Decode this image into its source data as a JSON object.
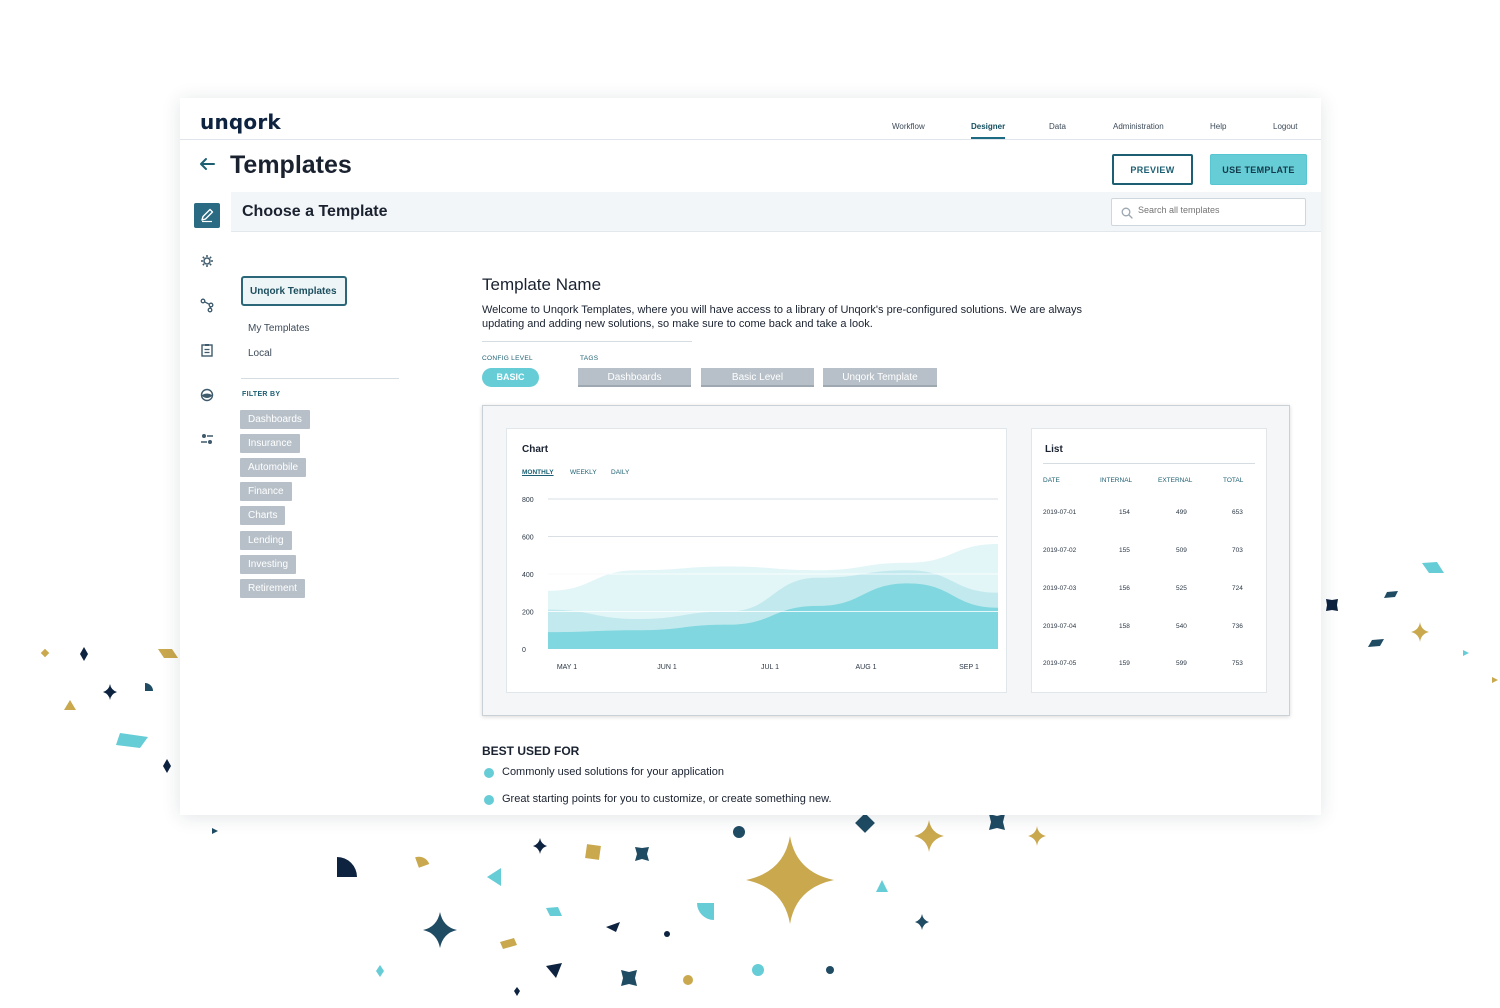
{
  "app": {
    "logo": "unqork"
  },
  "nav": [
    {
      "label": "Workflow",
      "active": false
    },
    {
      "label": "Designer",
      "active": true
    },
    {
      "label": "Data",
      "active": false
    },
    {
      "label": "Administration",
      "active": false
    },
    {
      "label": "Help",
      "active": false
    },
    {
      "label": "Logout",
      "active": false
    }
  ],
  "header": {
    "title": "Templates",
    "preview_label": "PREVIEW",
    "use_label": "USE TEMPLATE"
  },
  "choose": {
    "title": "Choose a Template",
    "search_placeholder": "Search all templates"
  },
  "rail_icons": [
    "pencil-icon",
    "gear-icon",
    "workflow-icon",
    "clipboard-icon",
    "palette-icon",
    "sliders-icon"
  ],
  "sidebar": {
    "active_tab": "Unqork Templates",
    "links": [
      "My Templates",
      "Local"
    ],
    "filter_label": "FILTER BY",
    "filters": [
      "Dashboards",
      "Insurance",
      "Automobile",
      "Finance",
      "Charts",
      "Lending",
      "Investing",
      "Retirement"
    ]
  },
  "template": {
    "name": "Template Name",
    "description": "Welcome to Unqork Templates, where you will have access to a library of Unqork's pre-configured solutions. We are always updating and adding new solutions, so make sure to come back and take a look.",
    "config_label": "CONFIG LEVEL",
    "config_value": "BASIC",
    "tags_label": "TAGS",
    "tags": [
      "Dashboards",
      "Basic Level",
      "Unqork Template"
    ]
  },
  "chart_card": {
    "title": "Chart",
    "periods": [
      {
        "label": "MONTHLY",
        "active": true
      },
      {
        "label": "WEEKLY",
        "active": false
      },
      {
        "label": "DAILY",
        "active": false
      }
    ]
  },
  "chart_data": {
    "type": "area",
    "title": "Chart",
    "x": [
      "MAY 1",
      "JUN 1",
      "JUL 1",
      "AUG 1",
      "SEP 1"
    ],
    "yticks": [
      0,
      200,
      400,
      600,
      800
    ],
    "ylim": [
      0,
      800
    ],
    "grid": true,
    "series": [
      {
        "values": [
          310,
          420,
          440,
          420,
          460,
          560
        ],
        "color": "#e2f5f7"
      },
      {
        "values": [
          210,
          160,
          200,
          380,
          420,
          300
        ],
        "color": "#bce8ec"
      },
      {
        "values": [
          90,
          100,
          130,
          230,
          350,
          220
        ],
        "color": "#76d4dc"
      }
    ]
  },
  "list_card": {
    "title": "List",
    "columns": [
      "DATE",
      "INTERNAL",
      "EXTERNAL",
      "TOTAL"
    ],
    "rows": [
      [
        "2019-07-01",
        "154",
        "499",
        "653"
      ],
      [
        "2019-07-02",
        "155",
        "509",
        "703"
      ],
      [
        "2019-07-03",
        "156",
        "525",
        "724"
      ],
      [
        "2019-07-04",
        "158",
        "540",
        "736"
      ],
      [
        "2019-07-05",
        "159",
        "599",
        "753"
      ]
    ]
  },
  "best_used": {
    "title": "BEST USED FOR",
    "items": [
      "Commonly used solutions for your application",
      "Great starting points for you to customize, or create something new."
    ]
  },
  "colors": {
    "accent": "#66ccd6",
    "primary": "#1c5f72",
    "navy": "#0d2340",
    "gold": "#c9a84e",
    "chip": "#b7c0c8"
  }
}
